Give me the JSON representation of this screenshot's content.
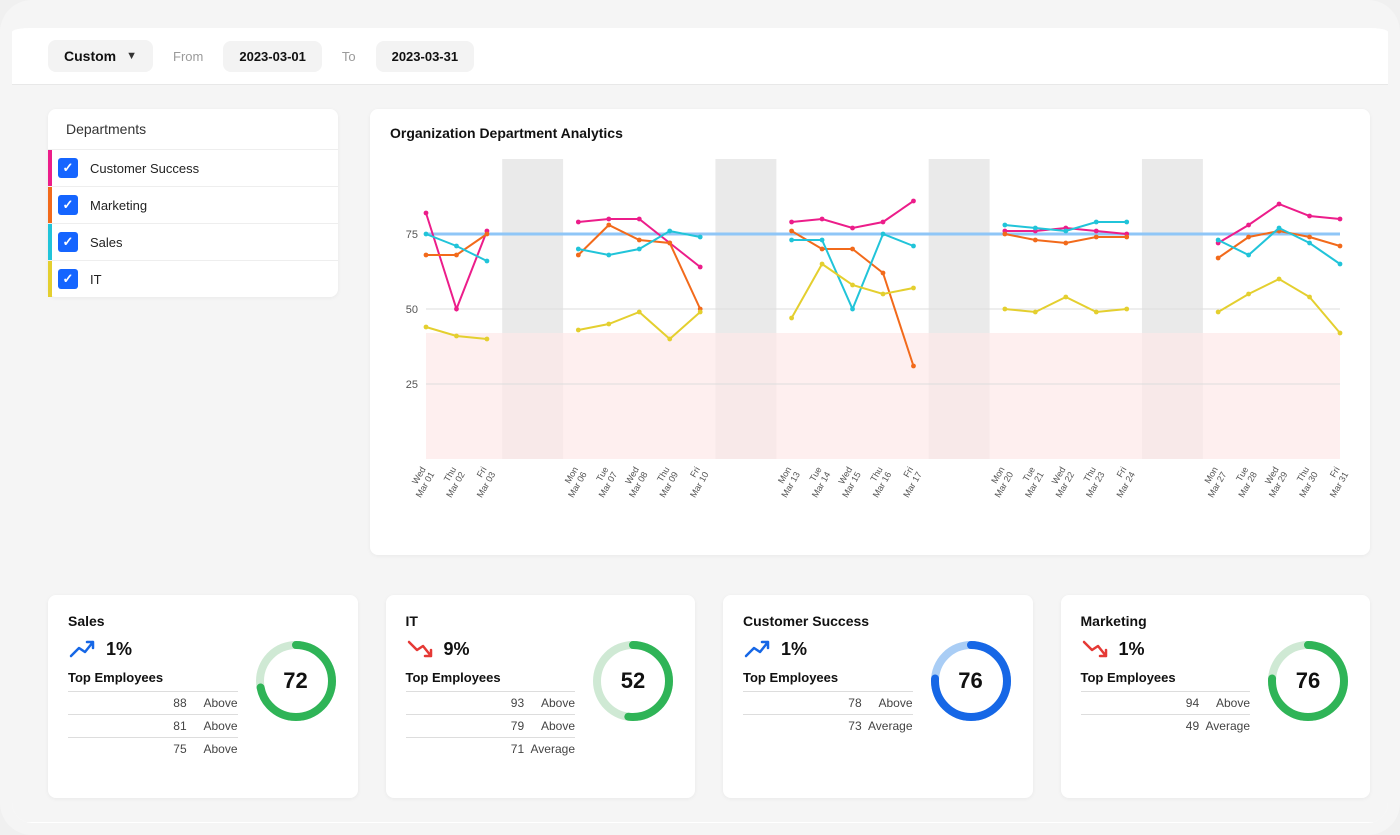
{
  "topbar": {
    "range_preset": "Custom",
    "from_label": "From",
    "to_label": "To",
    "from_date": "2023-03-01",
    "to_date": "2023-03-31"
  },
  "departments": {
    "title": "Departments",
    "items": [
      {
        "label": "Customer Success",
        "checked": true,
        "color": "#ec1d8a"
      },
      {
        "label": "Marketing",
        "checked": true,
        "color": "#f26a1b"
      },
      {
        "label": "Sales",
        "checked": true,
        "color": "#21c4d9"
      },
      {
        "label": "IT",
        "checked": true,
        "color": "#e4cf2f"
      }
    ]
  },
  "chart_title": "Organization Department Analytics",
  "chart_data": {
    "type": "line",
    "title": "Organization Department Analytics",
    "xlabel": "",
    "ylabel": "",
    "ylim": [
      0,
      100
    ],
    "y_ticks": [
      25,
      50,
      75
    ],
    "reference_line": 75,
    "low_band_max": 42,
    "weekend_bands": [
      [
        3,
        4
      ],
      [
        10,
        11
      ],
      [
        17,
        18
      ],
      [
        24,
        25
      ]
    ],
    "x_labels": [
      "Wed Mar 01",
      "Thu Mar 02",
      "Fri Mar 03",
      "",
      "",
      "Mon Mar 06",
      "Tue Mar 07",
      "Wed Mar 08",
      "Thu Mar 09",
      "Fri Mar 10",
      "",
      "",
      "Mon Mar 13",
      "Tue Mar 14",
      "Wed Mar 15",
      "Thu Mar 16",
      "Fri Mar 17",
      "",
      "",
      "Mon Mar 20",
      "Tue Mar 21",
      "Wed Mar 22",
      "Thu Mar 23",
      "Fri Mar 24",
      "",
      "",
      "Mon Mar 27",
      "Tue Mar 28",
      "Wed Mar 29",
      "Thu Mar 30",
      "Fri Mar 31"
    ],
    "series": [
      {
        "name": "Customer Success",
        "color": "#ec1d8a",
        "values": [
          82,
          50,
          76,
          null,
          null,
          79,
          80,
          80,
          72,
          64,
          null,
          null,
          79,
          80,
          77,
          79,
          86,
          null,
          null,
          76,
          76,
          77,
          76,
          75,
          null,
          null,
          72,
          78,
          85,
          81,
          80
        ]
      },
      {
        "name": "Marketing",
        "color": "#f26a1b",
        "values": [
          68,
          68,
          75,
          null,
          null,
          68,
          78,
          73,
          72,
          50,
          null,
          null,
          76,
          70,
          70,
          62,
          31,
          null,
          null,
          75,
          73,
          72,
          74,
          74,
          null,
          null,
          67,
          74,
          76,
          74,
          71
        ]
      },
      {
        "name": "Sales",
        "color": "#21c4d9",
        "values": [
          75,
          71,
          66,
          null,
          null,
          70,
          68,
          70,
          76,
          74,
          null,
          null,
          73,
          73,
          50,
          75,
          71,
          null,
          null,
          78,
          77,
          76,
          79,
          79,
          null,
          null,
          73,
          68,
          77,
          72,
          65
        ]
      },
      {
        "name": "IT",
        "color": "#e4cf2f",
        "values": [
          44,
          41,
          40,
          null,
          null,
          43,
          45,
          49,
          40,
          49,
          null,
          null,
          47,
          65,
          58,
          55,
          57,
          null,
          null,
          50,
          49,
          54,
          49,
          50,
          null,
          null,
          49,
          55,
          60,
          54,
          42
        ]
      }
    ]
  },
  "stats": [
    {
      "title": "Sales",
      "trend_dir": "up",
      "trend_pct": "1%",
      "gauge_value": 72,
      "gauge_color": "#2fb457",
      "gauge_track": "#cfe9d4",
      "top_title": "Top Employees",
      "rows": [
        {
          "name": "",
          "score": "88",
          "rating": "Above"
        },
        {
          "name": "",
          "score": "81",
          "rating": "Above"
        },
        {
          "name": "",
          "score": "75",
          "rating": "Above"
        }
      ]
    },
    {
      "title": "IT",
      "trend_dir": "down",
      "trend_pct": "9%",
      "gauge_value": 52,
      "gauge_color": "#2fb457",
      "gauge_track": "#cfe9d4",
      "top_title": "Top Employees",
      "rows": [
        {
          "name": "",
          "score": "93",
          "rating": "Above"
        },
        {
          "name": "",
          "score": "79",
          "rating": "Above"
        },
        {
          "name": "",
          "score": "71",
          "rating": "Average"
        }
      ]
    },
    {
      "title": "Customer Success",
      "trend_dir": "up",
      "trend_pct": "1%",
      "gauge_value": 76,
      "gauge_color": "#1667e6",
      "gauge_track": "#a9cdf5",
      "top_title": "Top Employees",
      "rows": [
        {
          "name": "",
          "score": "78",
          "rating": "Above"
        },
        {
          "name": "",
          "score": "73",
          "rating": "Average"
        }
      ]
    },
    {
      "title": "Marketing",
      "trend_dir": "down",
      "trend_pct": "1%",
      "gauge_value": 76,
      "gauge_color": "#2fb457",
      "gauge_track": "#cfe9d4",
      "top_title": "Top Employees",
      "rows": [
        {
          "name": "",
          "score": "94",
          "rating": "Above"
        },
        {
          "name": "",
          "score": "49",
          "rating": "Average"
        }
      ]
    }
  ]
}
